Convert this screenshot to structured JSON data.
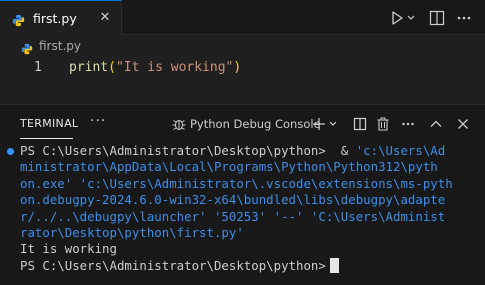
{
  "editor": {
    "tab": {
      "label": "first.py"
    },
    "breadcrumb": {
      "label": "first.py"
    },
    "code": {
      "line_number": "1",
      "fn": "print",
      "open": "(",
      "string": "\"It is working\"",
      "close": ")"
    }
  },
  "panel": {
    "active_tab": "TERMINAL",
    "terminal_name": "Python Debug Console",
    "lines": [
      {
        "segments": [
          {
            "text": "PS C:\\Users\\Administrator\\Desktop\\python>  & "
          },
          {
            "text": "'c:\\Users\\Ad",
            "style": "blue"
          }
        ]
      },
      {
        "segments": [
          {
            "text": "ministrator\\AppData\\Local\\Programs\\Python\\Python312\\pyth",
            "style": "blue"
          }
        ]
      },
      {
        "segments": [
          {
            "text": "on.exe' 'c:\\Users\\Administrator\\.vscode\\extensions\\ms-pyth",
            "style": "blue"
          }
        ]
      },
      {
        "segments": [
          {
            "text": "on.debugpy-2024.6.0-win32-x64\\bundled\\libs\\debugpy\\adapte",
            "style": "blue"
          }
        ]
      },
      {
        "segments": [
          {
            "text": "r/../..\\debugpy\\launcher' '50253' '--' 'C:\\Users\\Administ",
            "style": "blue"
          }
        ]
      },
      {
        "segments": [
          {
            "text": "rator\\Desktop\\python\\first.py'",
            "style": "blue"
          }
        ]
      },
      {
        "segments": [
          {
            "text": "It is working"
          }
        ]
      },
      {
        "segments": [
          {
            "text": "PS C:\\Users\\Administrator\\Desktop\\python>"
          }
        ]
      }
    ]
  },
  "colors": {
    "accent": "#0078d4",
    "terminal_path": "#3b8eea",
    "terminal_dot": "#3794ff"
  }
}
